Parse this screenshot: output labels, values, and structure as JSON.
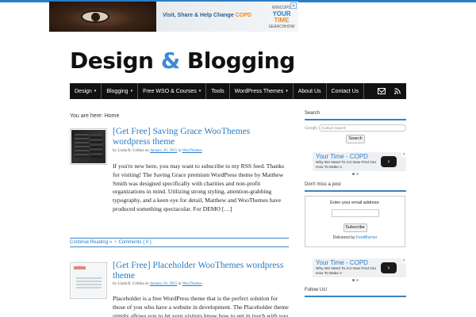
{
  "ad_banner": {
    "tagline_main": "Visit, Share & Help Change ",
    "tagline_highlight": "COPD",
    "logo_small_top": "WINCOPD",
    "logo_line1": "YOUR",
    "logo_line2": "TIME",
    "logo_small_bottom": "SEARCHHOW",
    "close_label": "✕"
  },
  "site": {
    "title_part1": "Design ",
    "title_amp": "&",
    "title_part2": " Blogging"
  },
  "nav": {
    "items": [
      {
        "label": "Design",
        "caret": "▾"
      },
      {
        "label": "Blogging",
        "caret": "▾"
      },
      {
        "label": "Free WSO & Courses",
        "caret": "▾"
      },
      {
        "label": "Tools",
        "caret": ""
      },
      {
        "label": "WordPress Themes",
        "caret": "▾"
      },
      {
        "label": "About Us",
        "caret": ""
      },
      {
        "label": "Contact Us",
        "caret": ""
      }
    ],
    "icons": [
      "mail-icon",
      "rss-icon"
    ]
  },
  "breadcrumb": {
    "text": "You are here: Home"
  },
  "posts": [
    {
      "title": "[Get Free] Saving Grace WooThemes wordpress theme",
      "meta_by": "by ",
      "meta_author": "Linda R. Collins",
      "meta_on": " on ",
      "meta_date": "January 26, 2015",
      "meta_in": " in ",
      "meta_category": "WooThemes",
      "body_lead": "If you're new here, you may want to subscribe to my RSS feed. Thanks for visiting!",
      "body_rest": " The Saving Grace premium WordPress theme by Matthew Smith was designed specifically with charities and non-profit organizations in mind. Utilizing strong styling, attention-grabbing typography, and a keen eye for detail, Matthew and WooThemes have produced something spectacular. For DEMO […]",
      "continue_label": "Continue Reading",
      "comments_label": "Comments { 0 }"
    },
    {
      "title": "[Get Free] Placeholder WooThemes wordpress theme",
      "meta_by": "by ",
      "meta_author": "Linda R. Collins",
      "meta_on": " on ",
      "meta_date": "January 26, 2015",
      "meta_in": " in ",
      "meta_category": "WooThemes",
      "body_lead": "Placeholder is a free WordPress theme that is the perfect solution for those of you who have a website in development. The Placeholder theme simply allows you to let your visitors know how to get in touch with you and how long it"
    }
  ],
  "sidebar": {
    "search": {
      "title": "Search",
      "google_mark": "Google",
      "placeholder": "Custom Search",
      "button": "Search"
    },
    "ad": {
      "title": "Your Time - COPD",
      "sub": "Why We Need To Act Now Find Out How To Make A",
      "button": "›",
      "close": "✕"
    },
    "subscribe": {
      "title": "Don't miss a post",
      "label": "Enter your email address:",
      "button": "Subscribe",
      "delivered_by": "Delivered by ",
      "feedburner": "FeedBurner"
    },
    "follow": {
      "title": "Follow Us!"
    }
  }
}
